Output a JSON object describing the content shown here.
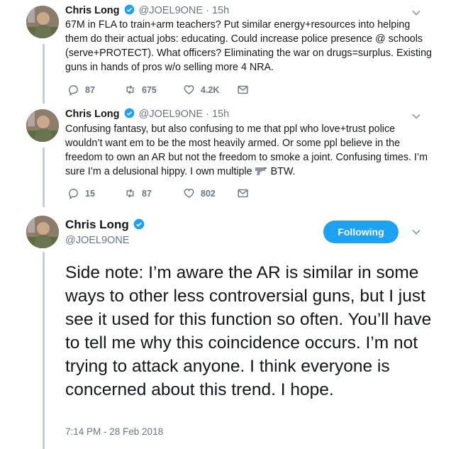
{
  "tweets": [
    {
      "name": "Chris Long",
      "handle": "@JOEL9ONE",
      "dot": "·",
      "time": "15h",
      "text": "67M in FLA to train+arm teachers? Put similar energy+resources into helping them do their actual jobs: educating. Could increase police presence @ schools (serve+PROTECT). What officers? Eliminating the war on drugs=surplus. Existing guns in hands of pros w/o selling more 4 NRA.",
      "replies": "87",
      "retweets": "675",
      "likes": "4.2K"
    },
    {
      "name": "Chris Long",
      "handle": "@JOEL9ONE",
      "dot": "·",
      "time": "15h",
      "text_before_icon": "Confusing fantasy, but also confusing to me that ppl who love+trust police wouldn’t want em to be the most heavily armed. Or some ppl believe in the freedom to own an AR but not the freedom to smoke a joint. Confusing times. I’m sure I’m a delusional hippy. I own multiple",
      "text_after_icon": "BTW.",
      "replies": "15",
      "retweets": "87",
      "likes": "802"
    }
  ],
  "main_tweet": {
    "name": "Chris Long",
    "handle": "@JOEL9ONE",
    "follow_label": "Following",
    "text": "Side note: I’m aware the AR is similar in some ways to other less controversial guns, but I just see it used for this function so often. You’ll have to tell me why this coincidence occurs. I’m not trying to attack anyone. I think everyone is concerned about this trend. I hope.",
    "timestamp": "7:14 PM - 28 Feb 2018"
  },
  "colors": {
    "accent": "#1da1f2",
    "muted": "#657786",
    "thread_line": "#c4cfd6"
  },
  "icons": [
    "verified-badge-icon",
    "reply-icon",
    "retweet-icon",
    "like-icon",
    "dm-icon",
    "chevron-down-icon",
    "pistol-emoji-icon"
  ]
}
